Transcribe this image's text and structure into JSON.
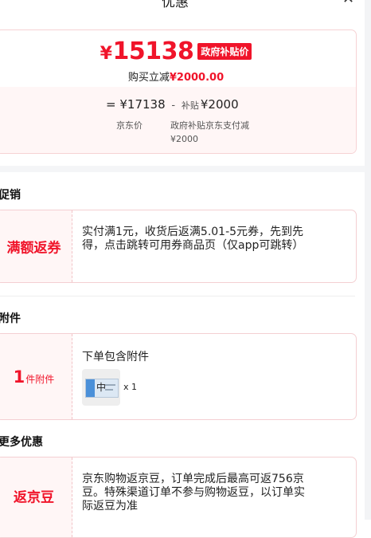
{
  "header": {
    "title": "优惠",
    "close_icon": "close-icon"
  },
  "price_card": {
    "currency": "¥",
    "final_price": "15138",
    "badge": "政府补贴价",
    "instant_label": "购买立减",
    "instant_amount": "¥2000.00",
    "formula": {
      "equals": "=",
      "jd_price": "¥17138",
      "minus": "-",
      "subsidy_label": "补贴",
      "subsidy_amount": "¥2000"
    },
    "jd_price_label": "京东价",
    "subsidy_desc": "政府补贴京东支付减¥2000"
  },
  "sections": {
    "promotion": {
      "title": "促销",
      "tag": "满额返券",
      "text": "实付满1元，收货后返满5.01-5元券，先到先得，点击跳转可用券商品页（仅app可跳转）"
    },
    "attachment": {
      "title": "附件",
      "count": "1",
      "count_word": "件附件",
      "desc": "下单包含附件",
      "thumb_char": "中",
      "quantity": "x 1"
    },
    "more": {
      "title": "更多优惠",
      "tag": "返京豆",
      "text": "京东购物返京豆，订单完成后最高可返756京豆。特殊渠道订单不参与购物返豆，以订单实际返豆为准"
    }
  },
  "colors": {
    "accent": "#f0142a",
    "tag_bg": "#fff6f6",
    "border": "#f4cfd2"
  }
}
